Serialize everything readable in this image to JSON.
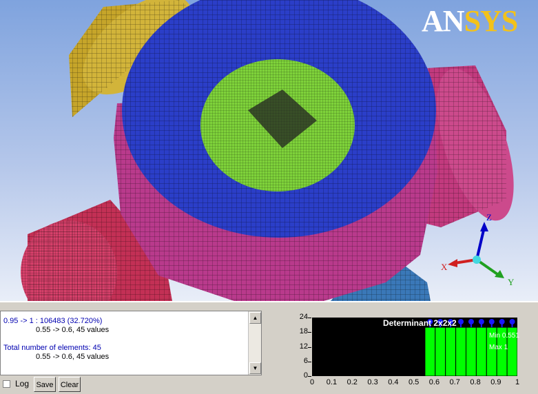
{
  "logo": {
    "an": "AN",
    "sys": "SYS"
  },
  "axes": {
    "x": "X",
    "y": "Y",
    "z": "Z"
  },
  "log": {
    "lines": [
      {
        "text": "0.95 -> 1 : 106483 (32.720%)"
      },
      {
        "text": "0.55 -> 0.6, 45 values"
      },
      {
        "text": "Total number of elements: 45"
      },
      {
        "text": "0.55 -> 0.6, 45 values"
      }
    ]
  },
  "controls": {
    "log_label": "Log",
    "save_label": "Save",
    "clear_label": "Clear",
    "log_checked": false
  },
  "histogram": {
    "title": "Determinant 2x2x2",
    "min_label": "Min 0.551",
    "max_label": "Max 1"
  },
  "chart_data": {
    "type": "bar",
    "title": "Determinant 2x2x2",
    "xlabel": "",
    "ylabel": "",
    "x_ticks": [
      "0",
      "0.1",
      "0.2",
      "0.3",
      "0.4",
      "0.5",
      "0.6",
      "0.7",
      "0.8",
      "0.9",
      "1"
    ],
    "y_ticks": [
      "0",
      "6",
      "12",
      "18",
      "24"
    ],
    "xlim": [
      0,
      1
    ],
    "ylim": [
      0,
      24
    ],
    "bars": [
      {
        "x0": 0.55,
        "x1": 0.6,
        "value": 20
      },
      {
        "x0": 0.6,
        "x1": 0.65,
        "value": 20
      },
      {
        "x0": 0.65,
        "x1": 0.7,
        "value": 20
      },
      {
        "x0": 0.7,
        "x1": 0.75,
        "value": 20
      },
      {
        "x0": 0.75,
        "x1": 0.8,
        "value": 20
      },
      {
        "x0": 0.8,
        "x1": 0.85,
        "value": 20
      },
      {
        "x0": 0.85,
        "x1": 0.9,
        "value": 20
      },
      {
        "x0": 0.9,
        "x1": 0.95,
        "value": 20
      },
      {
        "x0": 0.95,
        "x1": 1.0,
        "value": 20
      }
    ],
    "bar_color": "#00ff00",
    "marker_color": "#1a1aff",
    "grid": false,
    "annotations": [
      "Min 0.551",
      "Max 1"
    ]
  }
}
